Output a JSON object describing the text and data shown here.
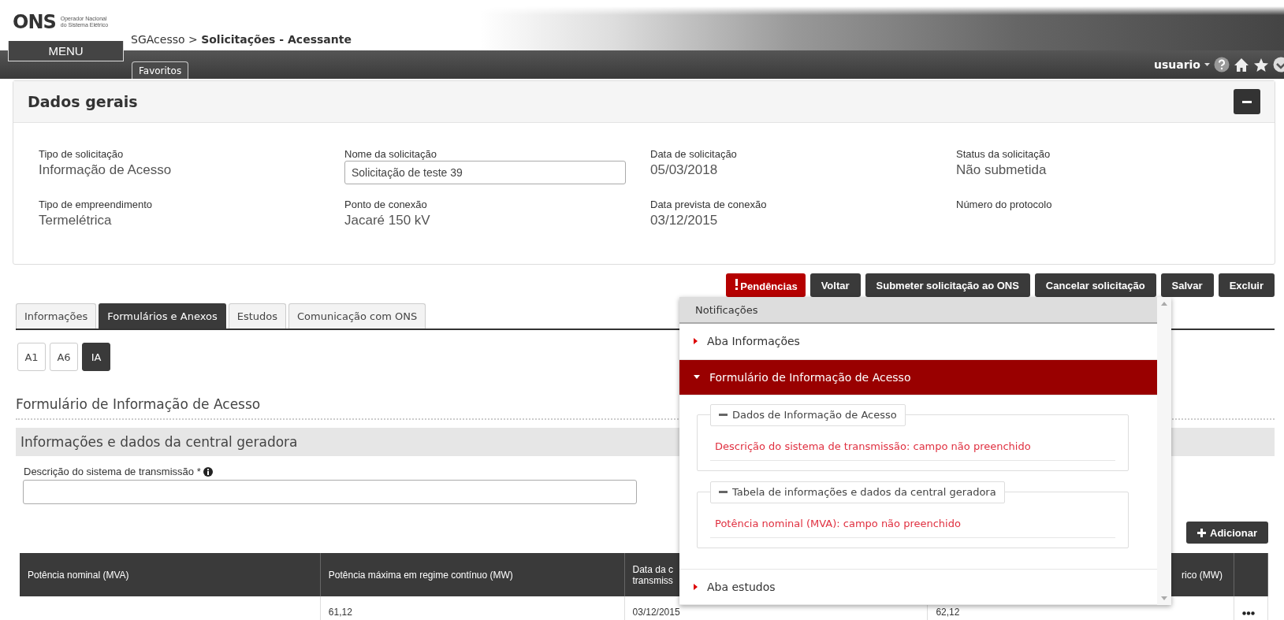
{
  "header": {
    "logo": "ONS",
    "logo_subtitle": [
      "Operador Nacional",
      "do Sistema Elétrico"
    ],
    "breadcrumb": {
      "root": "SGAcesso",
      "separator": ">",
      "current": "Solicitações - Acessante"
    },
    "menu_button": "MENU",
    "favorites_tab": "Favoritos",
    "user": "usuario"
  },
  "general_data": {
    "title": "Dados gerais",
    "fields": [
      {
        "label": "Tipo de solicitação",
        "value": "Informação de Acesso",
        "kind": "text"
      },
      {
        "label": "Nome da solicitação",
        "value": "Solicitação de teste 39",
        "kind": "input"
      },
      {
        "label": "Data de solicitação",
        "value": "05/03/2018",
        "kind": "text"
      },
      {
        "label": "Status da solicitação",
        "value": "Não submetida",
        "kind": "text"
      },
      {
        "label": "Tipo de empreendimento",
        "value": "Termelétrica",
        "kind": "text"
      },
      {
        "label": "Ponto de conexão",
        "value": "Jacaré 150 kV",
        "kind": "text"
      },
      {
        "label": "Data prevista de conexão",
        "value": "03/12/2015",
        "kind": "text"
      },
      {
        "label": "Número do protocolo",
        "kind": "text"
      }
    ]
  },
  "actions": [
    {
      "label": "Pendências",
      "kind": "alert"
    },
    {
      "label": "Voltar",
      "kind": "normal"
    },
    {
      "label": "Submeter solicitação ao ONS",
      "kind": "normal"
    },
    {
      "label": "Cancelar solicitação",
      "kind": "normal"
    },
    {
      "label": "Salvar",
      "kind": "normal"
    },
    {
      "label": "Excluir",
      "kind": "normal"
    }
  ],
  "tabs": [
    {
      "label": "Informações",
      "selected": false
    },
    {
      "label": "Formulários e Anexos",
      "selected": true
    },
    {
      "label": "Estudos",
      "selected": false
    },
    {
      "label": "Comunicação com ONS",
      "selected": false
    }
  ],
  "form_tabs": [
    {
      "label": "A1",
      "selected": false
    },
    {
      "label": "A6",
      "selected": false
    },
    {
      "label": "IA",
      "selected": true
    }
  ],
  "form_title": "Formulário de Informação de Acesso",
  "section_title": "Informações e dados da central geradora",
  "field": {
    "label": "Descrição do sistema de transmissão *"
  },
  "add_button": "Adicionar",
  "table": {
    "columns": [
      "Potência nominal (MVA)",
      "Potência máxima em regime contínuo (MW)",
      "Data da c\ntransmiss",
      "rico (MW)"
    ],
    "rows": [
      {
        "cells": [
          null,
          "61,12",
          "03/12/2015",
          "62,12"
        ]
      }
    ]
  },
  "notifications": {
    "title": "Notificações",
    "groups": [
      {
        "label": "Aba Informações",
        "expanded": false
      },
      {
        "label": "Formulário de Informação de Acesso",
        "expanded": true,
        "sections": [
          {
            "title": "Dados de Informação de Acesso",
            "messages": [
              "Descrição do sistema de transmissão: campo não preenchido"
            ]
          },
          {
            "title": "Tabela de informações e dados da central geradora",
            "messages": [
              "Potência nominal (MVA): campo não preenchido"
            ]
          }
        ]
      },
      {
        "label": "Aba estudos",
        "expanded": false
      }
    ]
  }
}
